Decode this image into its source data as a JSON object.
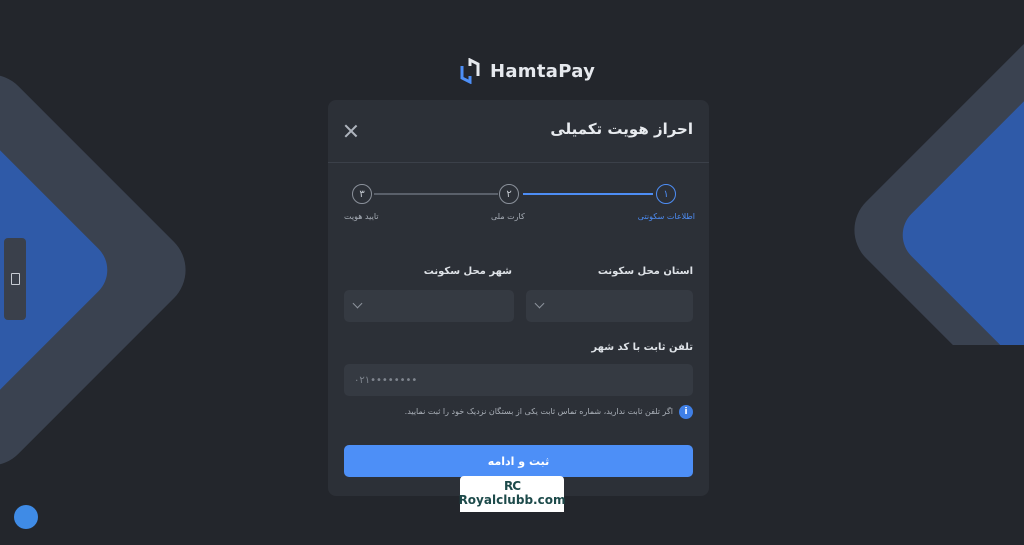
{
  "brand": {
    "logo_text": "HamtaPay",
    "logo_icon": "hamtapay-logo-icon"
  },
  "modal": {
    "title": "احراز هویت تکمیلی",
    "close_icon": "close-icon",
    "steps": [
      {
        "number": "۱",
        "label": "اطلاعات سکونتی",
        "active": true
      },
      {
        "number": "۲",
        "label": "کارت ملی",
        "active": false
      },
      {
        "number": "۳",
        "label": "تایید هویت",
        "active": false
      }
    ],
    "province": {
      "label": "استان محل سکونت",
      "value": ""
    },
    "city": {
      "label": "شهر محل سکونت",
      "value": ""
    },
    "phone": {
      "label": "تلفن ثابت با کد شهر",
      "placeholder": "۰۲۱••••••••",
      "value": ""
    },
    "info": {
      "icon": "info-icon",
      "text": "اگر تلفن ثابت ندارید، شماره تماس ثابت یکی از بستگان نزدیک خود را ثبت نمایید."
    },
    "submit_label": "ثبت و ادامه"
  },
  "watermark": {
    "mark": "RC",
    "text": "Royalclubb.com"
  },
  "colors": {
    "background": "#23262c",
    "card": "#2c3037",
    "accent": "#4d8ff7",
    "decor_blue": "#2f5aa8"
  }
}
